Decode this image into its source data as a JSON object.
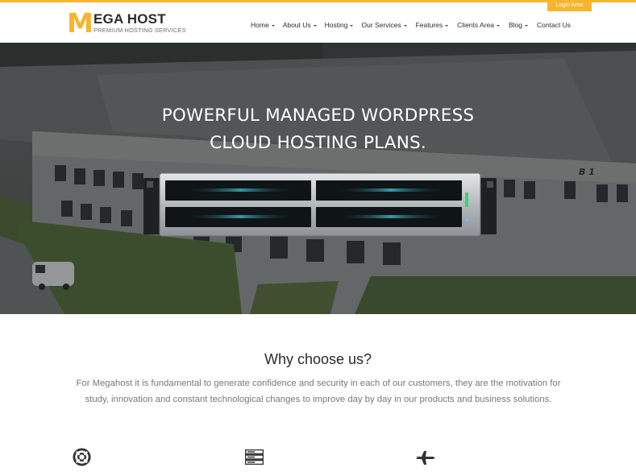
{
  "brand": {
    "logo_initial": "M",
    "logo_rest": "EGA",
    "logo_host": "HOST",
    "tagline": "PREMIUM HOSTING SERVICES",
    "accent_color": "#f5b52d"
  },
  "header": {
    "login_label": "Login Area"
  },
  "nav": {
    "items": [
      {
        "label": "Home",
        "has_dropdown": true
      },
      {
        "label": "About Us",
        "has_dropdown": true
      },
      {
        "label": "Hosting",
        "has_dropdown": true
      },
      {
        "label": "Our Services",
        "has_dropdown": true
      },
      {
        "label": "Features",
        "has_dropdown": true
      },
      {
        "label": "Clients Area",
        "has_dropdown": true
      },
      {
        "label": "Blog",
        "has_dropdown": true
      },
      {
        "label": "Contact Us",
        "has_dropdown": false
      }
    ]
  },
  "hero": {
    "title_line1": "POWERFUL MANAGED WORDPRESS",
    "title_line2": "CLOUD HOSTING PLANS.",
    "image": "aerial-datacenter-with-server"
  },
  "why": {
    "title": "Why choose us?",
    "text": "For Megahost it is fundamental to generate confidence and security in each of our customers, they are the motivation for study, innovation and constant technological changes to improve day by day in our products and business solutions."
  },
  "features": {
    "icons": [
      "lifebuoy-icon",
      "server-stack-icon",
      "jet-icon"
    ]
  }
}
